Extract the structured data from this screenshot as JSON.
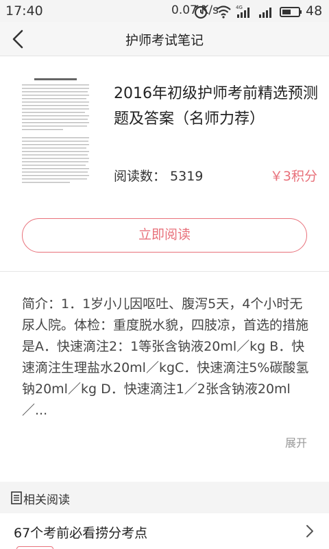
{
  "status_bar": {
    "time": "17:40",
    "net_speed": "0.07 K/s",
    "battery": "48",
    "icons": [
      "alarm-icon",
      "wifi-icon",
      "signal-4g-icon",
      "signal-icon",
      "battery-icon"
    ]
  },
  "nav": {
    "title": "护师考试笔记",
    "back_icon": "back-arrow-icon"
  },
  "book": {
    "cover_icon": "document-cover-thumbnail",
    "title": "2016年初级护师考前精选预测题及答案（名师力荐）",
    "reads_label": "阅读数：",
    "reads_count": "5319",
    "price": "￥3积分",
    "read_button": "立即阅读"
  },
  "intro": {
    "text": "简介：1．1岁小儿因呕吐、腹泻5天，4个小时无尿人院。体检：重度脱水貌，四肢凉，首选的措施是A．快速滴注2：1等张含钠液20ml／kg B．快速滴注生理盐水20ml／kgC．快速滴注5%碳酸氢钠20ml／kg D．快速滴注1／2张含钠液20ml／...",
    "expand_label": "展开"
  },
  "related": {
    "header_icon": "document-icon",
    "header": "相关阅读",
    "items": [
      {
        "title": "67个考前必看捞分考点",
        "chevron_icon": "chevron-right-icon"
      }
    ]
  },
  "colors": {
    "accent": "#e8707a",
    "bar_bg": "#f4f4f4"
  }
}
